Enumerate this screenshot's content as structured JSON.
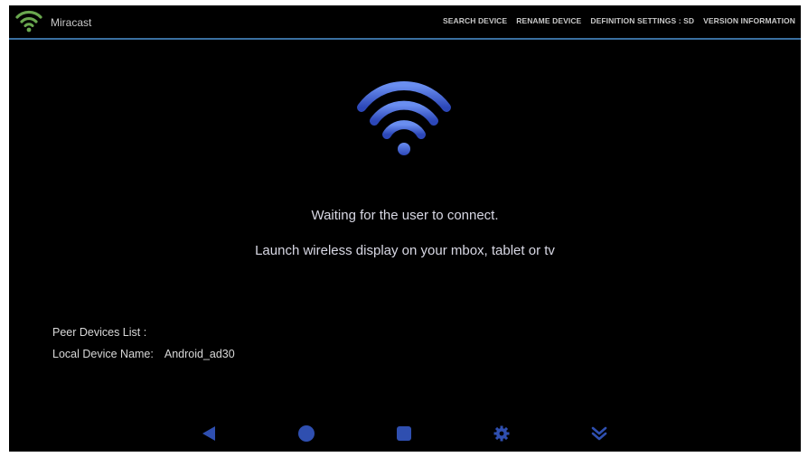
{
  "app": {
    "title": "Miracast",
    "icon": "wifi-icon"
  },
  "menu": {
    "items": [
      {
        "label": "SEARCH DEVICE"
      },
      {
        "label": "RENAME DEVICE"
      },
      {
        "label": "DEFINITION SETTINGS : SD"
      },
      {
        "label": "VERSION INFORMATION"
      }
    ]
  },
  "status": {
    "icon": "wifi-icon",
    "line1": "Waiting for the user to connect.",
    "line2": "Launch wireless display on your mbox, tablet or tv"
  },
  "device": {
    "peer_label": "Peer Devices List :",
    "local_label": "Local Device Name:",
    "local_value": "Android_ad30"
  },
  "navbar": {
    "buttons": [
      "back-icon",
      "home-icon",
      "recents-icon",
      "settings-icon",
      "expand-down-icon"
    ],
    "color": "#2f4fb0"
  },
  "colors": {
    "background": "#000000",
    "accent": "#3a6fa0",
    "wifi_blue": "#3e5fc8"
  }
}
